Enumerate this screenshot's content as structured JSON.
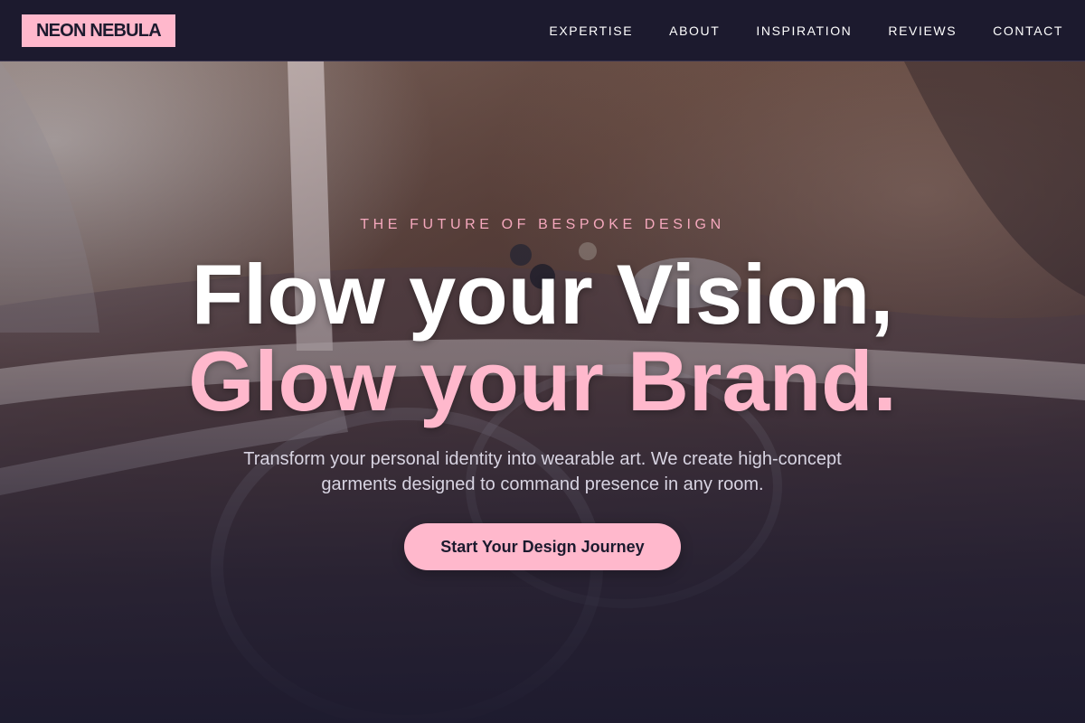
{
  "brand": {
    "logo_text": "NEON NEBULA"
  },
  "nav": {
    "items": [
      {
        "label": "EXPERTISE"
      },
      {
        "label": "ABOUT"
      },
      {
        "label": "INSPIRATION"
      },
      {
        "label": "REVIEWS"
      },
      {
        "label": "CONTACT"
      }
    ]
  },
  "hero": {
    "eyebrow": "THE FUTURE OF BESPOKE DESIGN",
    "headline_line1": "Flow your Vision,",
    "headline_line2": "Glow your Brand.",
    "subtext": "Transform your personal identity into wearable art. We create high-concept garments designed to command presence in any room.",
    "cta_label": "Start Your Design Journey",
    "background_image": "tailoring-fabric-measuring-tape-photo"
  },
  "colors": {
    "accent": "#ffb8cc",
    "background": "#1c1a2e",
    "text_light": "#ffffff",
    "subtext": "#d8d4e2",
    "eyebrow": "#f5a8bd"
  }
}
